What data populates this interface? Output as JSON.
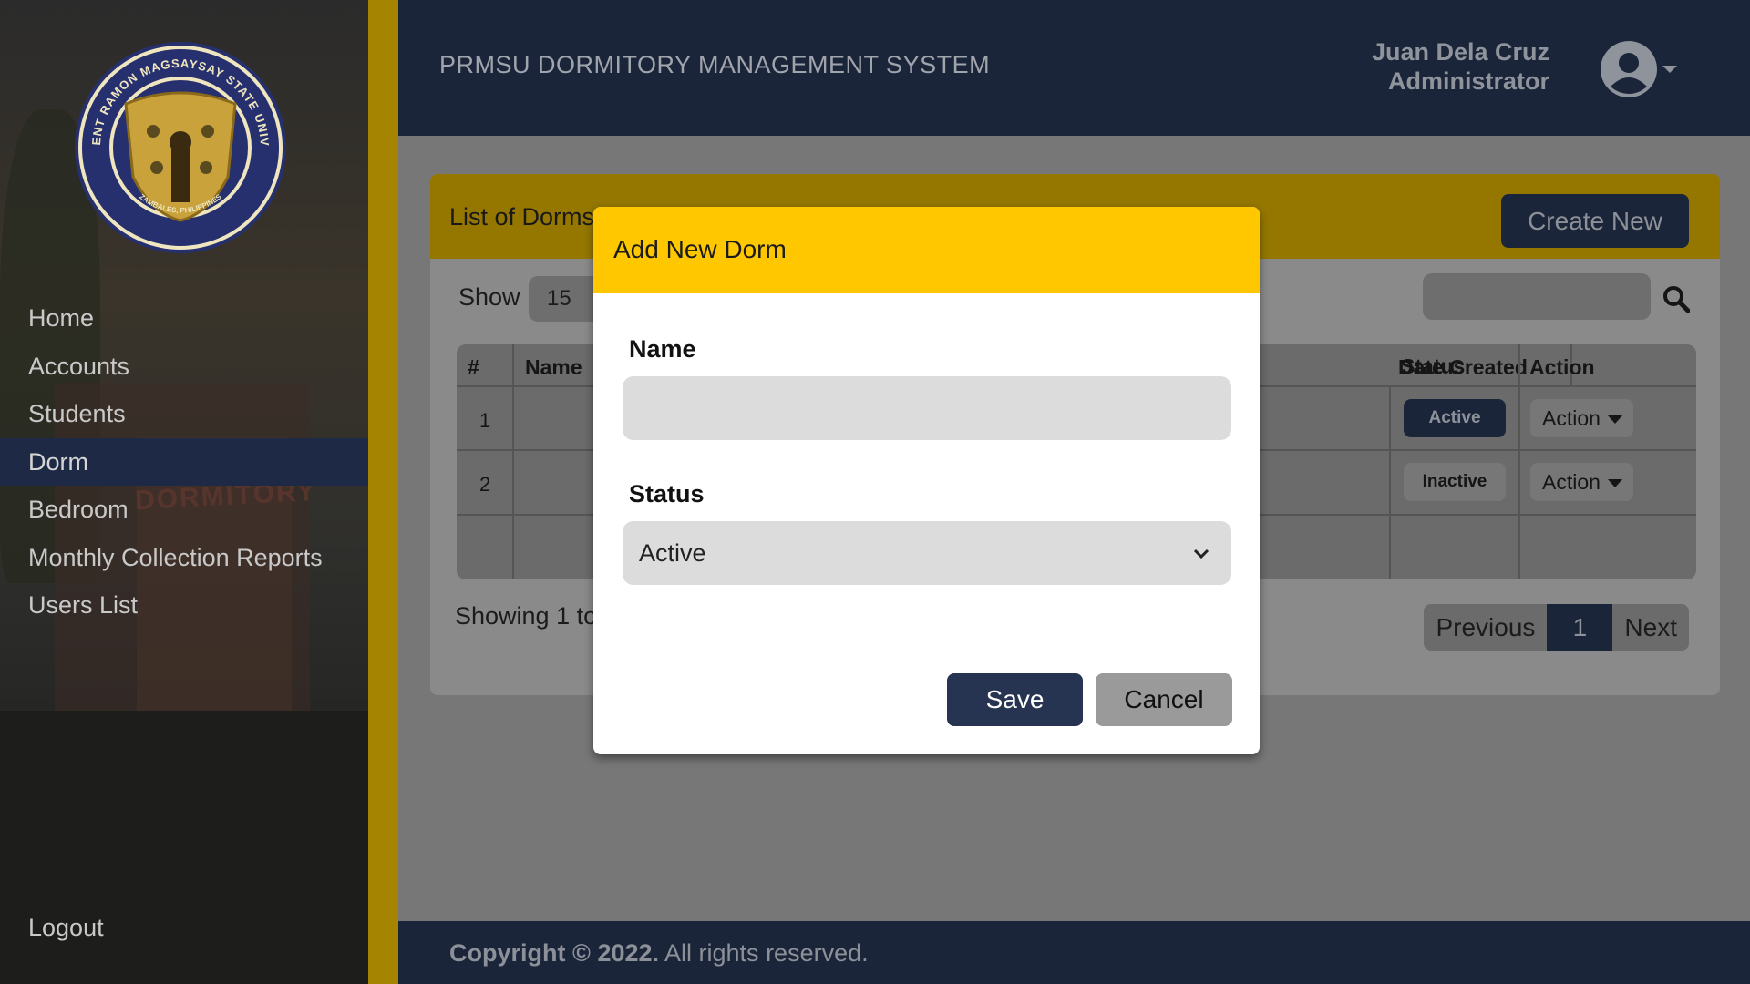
{
  "app": {
    "title": "PRMSU DORMITORY MANAGEMENT SYSTEM"
  },
  "user": {
    "name": "Juan Dela Cruz",
    "role": "Administrator"
  },
  "logo": {
    "text_top": "PRESIDENT RAMON MAGSAYSAY STATE UNIVERSITY",
    "text_bottom": "ZAMBALES, PHILIPPINES"
  },
  "sidebar": {
    "items": [
      {
        "label": "Home"
      },
      {
        "label": "Accounts"
      },
      {
        "label": "Students"
      },
      {
        "label": "Dorm",
        "active": true
      },
      {
        "label": "Bedroom"
      },
      {
        "label": "Monthly Collection Reports"
      },
      {
        "label": "Users List"
      }
    ],
    "logout": "Logout",
    "background_text": "DORMITORY"
  },
  "card": {
    "title": "List of Dorms",
    "create_label": "Create New",
    "show_label": "Show",
    "show_value": "15",
    "table": {
      "headers": [
        "#",
        "Name",
        "Date Created",
        "Status",
        "Action"
      ],
      "rows": [
        {
          "num": "1",
          "status": "Active",
          "action": "Action"
        },
        {
          "num": "2",
          "status": "Inactive",
          "action": "Action"
        }
      ]
    },
    "showing_text": "Showing 1 to",
    "pager": {
      "prev": "Previous",
      "page": "1",
      "next": "Next"
    }
  },
  "footer": {
    "copyright": "Copyright",
    "symbol": "©",
    "year": "2022.",
    "rights": "All rights reserved."
  },
  "modal": {
    "title": "Add New Dorm",
    "name_label": "Name",
    "name_value": "",
    "status_label": "Status",
    "status_value": "Active",
    "save_label": "Save",
    "cancel_label": "Cancel"
  },
  "colors": {
    "navy": "#1b2539",
    "gold": "#a48400",
    "modal_header": "#fec700",
    "save": "#263452"
  }
}
